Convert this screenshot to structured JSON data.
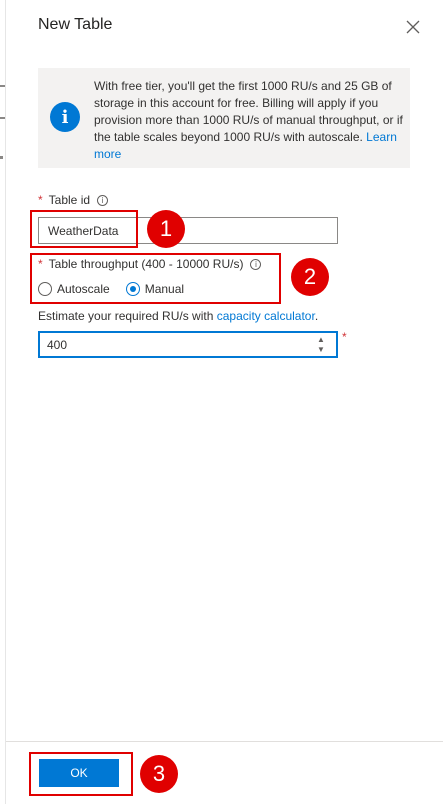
{
  "panel": {
    "title": "New Table",
    "info": {
      "text": "With free tier, you'll get the first 1000 RU/s and 25 GB of storage in this account for free. Billing will apply if you provision more than 1000 RU/s of manual throughput, or if the table scales beyond 1000 RU/s with autoscale.",
      "link_text": "Learn more"
    },
    "table_id": {
      "required_mark": "*",
      "label": "Table id",
      "value": "WeatherData"
    },
    "throughput": {
      "required_mark": "*",
      "label": "Table throughput (400 - 10000 RU/s)",
      "options": [
        {
          "label": "Autoscale",
          "selected": false
        },
        {
          "label": "Manual",
          "selected": true
        }
      ]
    },
    "estimate": {
      "text": "Estimate your required RU/s with",
      "link_text": "capacity calculator",
      "suffix": "."
    },
    "ru_input": {
      "value": "400",
      "required_mark": "*"
    },
    "ok_label": "OK"
  },
  "callouts": [
    "1",
    "2",
    "3"
  ],
  "icons": {
    "info": "info-icon",
    "tooltip": "tooltip-icon",
    "close": "close-icon"
  },
  "colors": {
    "accent": "#0078d4",
    "callout": "#e00000",
    "required": "#d13438"
  }
}
